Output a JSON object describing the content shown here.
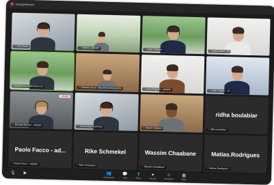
{
  "recording": {
    "label": "Enregistrement"
  },
  "participants": [
    {
      "name": "Anis Essid",
      "big_name": "",
      "muted": true
    },
    {
      "name": "Sabrina GBSDF",
      "big_name": "",
      "muted": true
    },
    {
      "name": "Julian Wegner",
      "big_name": "",
      "muted": true
    },
    {
      "name": "Ingrid Zeller - AI",
      "big_name": "",
      "muted": true
    },
    {
      "name": "Abdelkrimasch@Gmail.com",
      "big_name": "",
      "muted": false
    },
    {
      "name": "Roberta Vassi - BlackForestSolutions",
      "big_name": "",
      "muted": true
    },
    {
      "name": "Luca Negroni - adelphi",
      "big_name": "",
      "muted": true
    },
    {
      "name": "Leyla Yugeto - AI",
      "big_name": "",
      "muted": true
    },
    {
      "name": "Richard Berner - adelphi",
      "big_name": "",
      "muted": true,
      "badge": "adelphi"
    },
    {
      "name": "Omar Abed Rahman",
      "big_name": "",
      "muted": true
    },
    {
      "name": "Steven Heijnen",
      "big_name": "",
      "muted": true
    },
    {
      "name": "ridha boulabiar",
      "big_name": "ridha boulabiar",
      "muted": true
    },
    {
      "name": "Paolo Facco - adelphi",
      "big_name": "Paolo Facco - ad...",
      "muted": true
    },
    {
      "name": "Rike Schmekel",
      "big_name": "Rike Schmekel",
      "muted": true
    },
    {
      "name": "Wassim Chaabane",
      "big_name": "Wassim Chaabane",
      "muted": true
    },
    {
      "name": "Matias Rodrigues",
      "big_name": "Matias.Rodrigues",
      "muted": true
    }
  ],
  "toolbar": {
    "unmute": "Unmute",
    "video": "Video",
    "participants": "Participants",
    "chat": "Chat",
    "share": "Share",
    "record": "Record",
    "reactions": "Reactions",
    "apps": "Apps"
  },
  "colors": {
    "active_speaker": "#78d24b",
    "share_green": "#2fbf55"
  }
}
